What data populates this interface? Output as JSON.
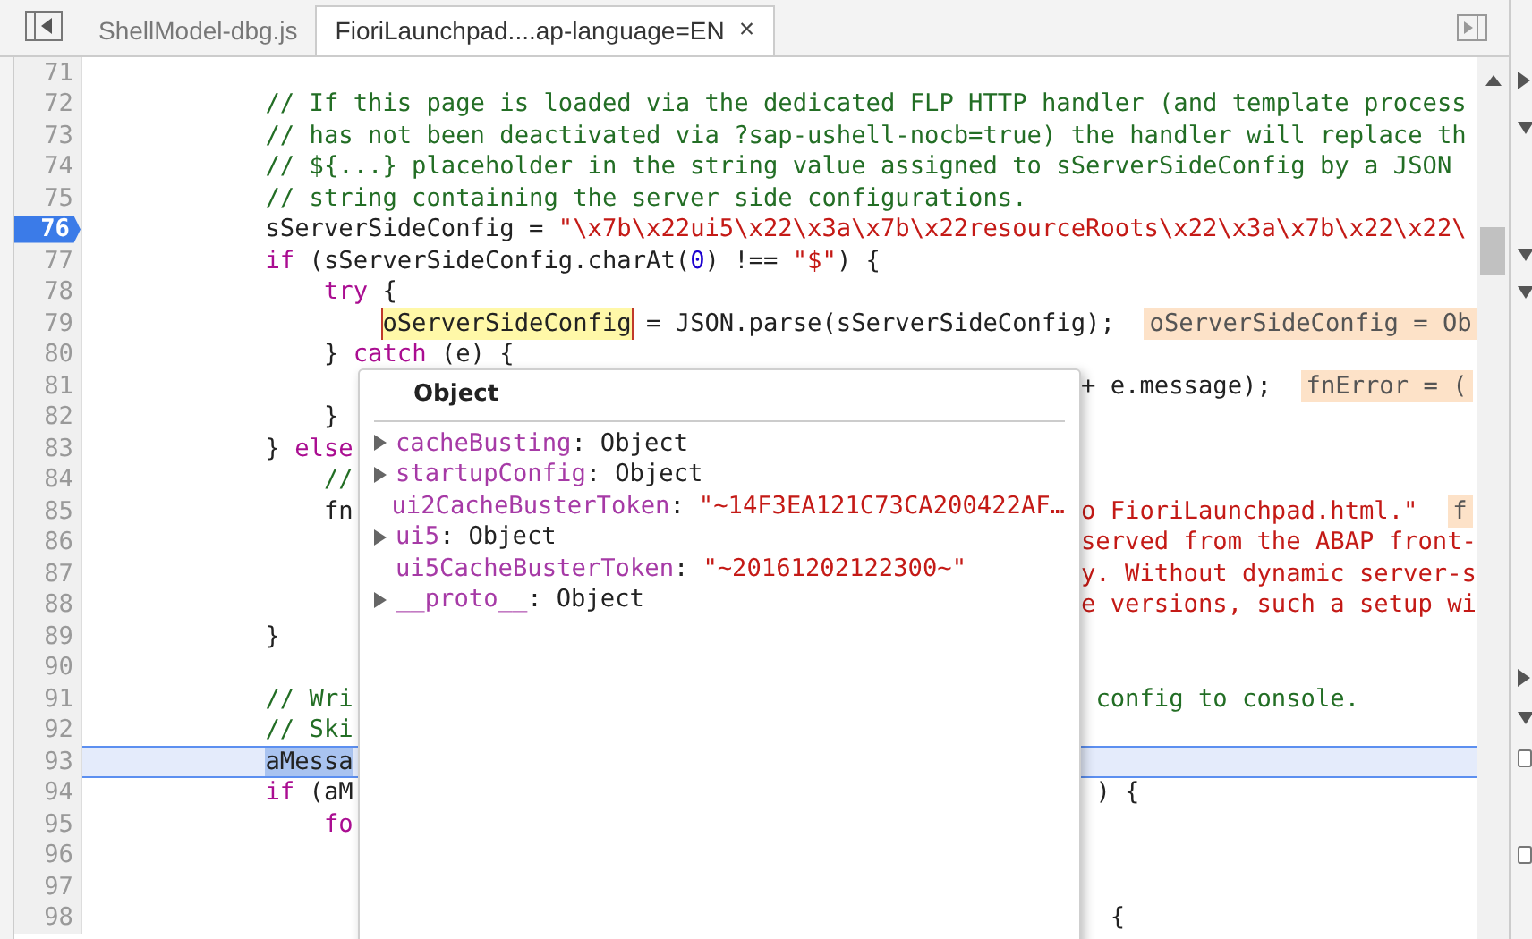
{
  "tabs": [
    {
      "label": "ShellModel-dbg.js",
      "selected": false,
      "closable": false
    },
    {
      "label": "FioriLaunchpad....ap-language=EN",
      "selected": true,
      "closable": true
    }
  ],
  "close_glyph": "×",
  "lines": [
    {
      "number": "71",
      "breakpoint": false,
      "paused": false
    },
    {
      "number": "72",
      "breakpoint": false,
      "paused": false,
      "code": [
        {
          "kind": "comment",
          "text": "            // If this page is loaded via the dedicated FLP HTTP handler (and template process"
        }
      ]
    },
    {
      "number": "73",
      "breakpoint": false,
      "paused": false,
      "code": [
        {
          "kind": "comment",
          "text": "            // has not been deactivated via ?sap-ushell-nocb=true) the handler will replace th"
        }
      ]
    },
    {
      "number": "74",
      "breakpoint": false,
      "paused": false,
      "code": [
        {
          "kind": "comment",
          "text": "            // ${...} placeholder in the string value assigned to sServerSideConfig by a JSON"
        }
      ]
    },
    {
      "number": "75",
      "breakpoint": false,
      "paused": false,
      "code": [
        {
          "kind": "comment",
          "text": "            // string containing the server side configurations."
        }
      ]
    },
    {
      "number": "76",
      "breakpoint": true,
      "paused": false,
      "code": [
        {
          "kind": "plain",
          "text": "            sServerSideConfig = "
        },
        {
          "kind": "string",
          "text": "\"\\x7b\\x22ui5\\x22\\x3a\\x7b\\x22resourceRoots\\x22\\x3a\\x7b\\x22\\x22\\"
        }
      ]
    },
    {
      "number": "77",
      "breakpoint": false,
      "paused": false,
      "code": [
        {
          "kind": "keyword",
          "text": "            if"
        },
        {
          "kind": "plain",
          "text": " (sServerSideConfig.charAt("
        },
        {
          "kind": "number",
          "text": "0"
        },
        {
          "kind": "plain",
          "text": ") !== "
        },
        {
          "kind": "string",
          "text": "\"$\""
        },
        {
          "kind": "plain",
          "text": ") {"
        }
      ]
    },
    {
      "number": "78",
      "breakpoint": false,
      "paused": false,
      "code": [
        {
          "kind": "keyword",
          "text": "                try"
        },
        {
          "kind": "plain",
          "text": " {"
        }
      ]
    },
    {
      "number": "79",
      "breakpoint": false,
      "paused": false,
      "code": [
        {
          "kind": "hover",
          "text": "                    oServerSideConfig"
        },
        {
          "kind": "plain",
          "text": " = JSON.parse(sServerSideConfig);  "
        },
        {
          "kind": "value",
          "text": "oServerSideConfig = Ob"
        }
      ]
    },
    {
      "number": "80",
      "breakpoint": false,
      "paused": false,
      "code": [
        {
          "kind": "plain",
          "text": "                } "
        },
        {
          "kind": "keyword",
          "text": "catch"
        },
        {
          "kind": "plain",
          "text": " (e) {"
        }
      ]
    },
    {
      "number": "81",
      "breakpoint": false,
      "paused": false,
      "code_right": [
        {
          "kind": "plain",
          "text": "+ e.message);  "
        },
        {
          "kind": "value",
          "text": "fnError = ("
        }
      ]
    },
    {
      "number": "82",
      "breakpoint": false,
      "paused": false,
      "code": [
        {
          "kind": "plain",
          "text": "                }"
        }
      ]
    },
    {
      "number": "83",
      "breakpoint": false,
      "paused": false,
      "code": [
        {
          "kind": "plain",
          "text": "            } "
        },
        {
          "kind": "keyword",
          "text": "else"
        }
      ]
    },
    {
      "number": "84",
      "breakpoint": false,
      "paused": false,
      "code": [
        {
          "kind": "comment",
          "text": "                //"
        }
      ]
    },
    {
      "number": "85",
      "breakpoint": false,
      "paused": false,
      "code": [
        {
          "kind": "plain",
          "text": "                fn"
        }
      ],
      "code_right": [
        {
          "kind": "string",
          "text": "o FioriLaunchpad.html.\"  "
        },
        {
          "kind": "value",
          "text": "f"
        }
      ]
    },
    {
      "number": "86",
      "breakpoint": false,
      "paused": false,
      "code_right": [
        {
          "kind": "string",
          "text": "served from the ABAP front-"
        }
      ]
    },
    {
      "number": "87",
      "breakpoint": false,
      "paused": false,
      "code_right": [
        {
          "kind": "string",
          "text": "y. Without dynamic server-s"
        }
      ]
    },
    {
      "number": "88",
      "breakpoint": false,
      "paused": false,
      "code_right": [
        {
          "kind": "string",
          "text": "e versions, such a setup wi"
        }
      ]
    },
    {
      "number": "89",
      "breakpoint": false,
      "paused": false,
      "code": [
        {
          "kind": "plain",
          "text": "            }"
        }
      ]
    },
    {
      "number": "90",
      "breakpoint": false,
      "paused": false
    },
    {
      "number": "91",
      "breakpoint": false,
      "paused": false,
      "code": [
        {
          "kind": "comment",
          "text": "            // Wri"
        }
      ],
      "code_right": [
        {
          "kind": "comment",
          "text": " config to console."
        }
      ]
    },
    {
      "number": "92",
      "breakpoint": false,
      "paused": false,
      "code": [
        {
          "kind": "comment",
          "text": "            // Ski"
        }
      ]
    },
    {
      "number": "93",
      "breakpoint": false,
      "paused": true,
      "code": [
        {
          "kind": "selection",
          "text": "            aMessa"
        }
      ]
    },
    {
      "number": "94",
      "breakpoint": false,
      "paused": false,
      "code": [
        {
          "kind": "keyword",
          "text": "            if"
        },
        {
          "kind": "plain",
          "text": " (aM"
        }
      ],
      "code_right": [
        {
          "kind": "plain",
          "text": " ) {"
        }
      ]
    },
    {
      "number": "95",
      "breakpoint": false,
      "paused": false,
      "code": [
        {
          "kind": "keyword",
          "text": "                fo"
        }
      ]
    },
    {
      "number": "96",
      "breakpoint": false,
      "paused": false
    },
    {
      "number": "97",
      "breakpoint": false,
      "paused": false
    },
    {
      "number": "98",
      "breakpoint": false,
      "paused": false,
      "code_right": [
        {
          "kind": "plain",
          "text": "  {"
        }
      ]
    }
  ],
  "popover": {
    "title": "Object",
    "properties": [
      {
        "name": "cacheBusting",
        "colon": ":",
        "expandable": true,
        "kind": "object",
        "value": "Object"
      },
      {
        "name": "startupConfig",
        "colon": ":",
        "expandable": true,
        "kind": "object",
        "value": "Object"
      },
      {
        "name": "ui2CacheBusterToken",
        "colon": ":",
        "expandable": false,
        "kind": "string",
        "value": "\"~14F3EA121C73CA200422AF…"
      },
      {
        "name": "ui5",
        "colon": ":",
        "expandable": true,
        "kind": "object",
        "value": "Object"
      },
      {
        "name": "ui5CacheBusterToken",
        "colon": ":",
        "expandable": false,
        "kind": "string",
        "value": "\"~20161202122300~\""
      },
      {
        "name": "__proto__",
        "colon": ":",
        "expandable": true,
        "kind": "object",
        "value": "Object"
      }
    ]
  }
}
